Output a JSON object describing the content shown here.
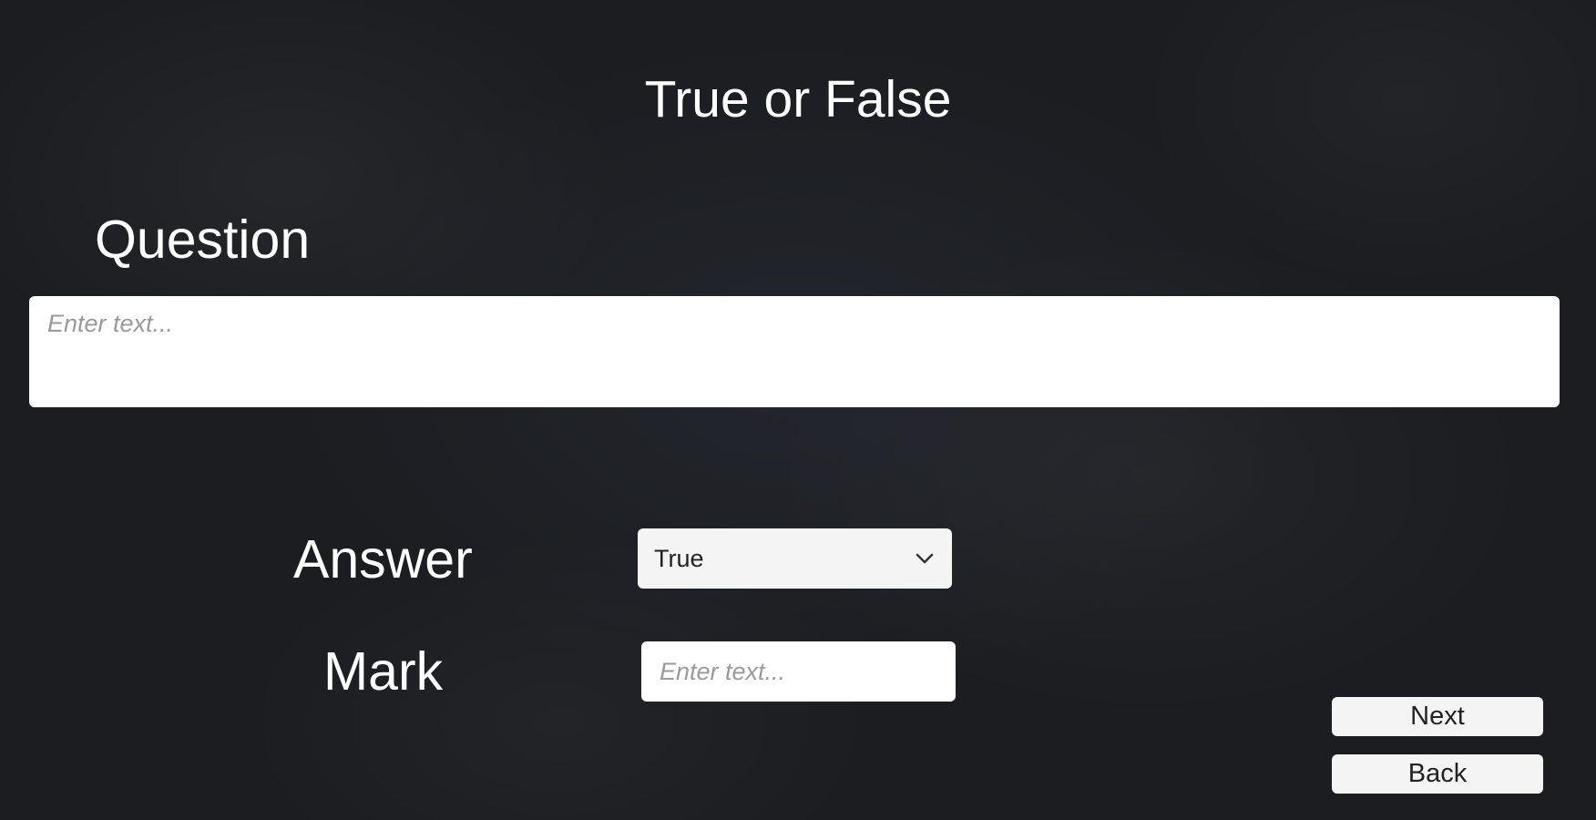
{
  "page": {
    "title": "True or False"
  },
  "question": {
    "label": "Question",
    "placeholder": "Enter text..."
  },
  "answer": {
    "label": "Answer",
    "selected": "True",
    "icon": "chevron-down-icon"
  },
  "mark": {
    "label": "Mark",
    "placeholder": "Enter text..."
  },
  "buttons": {
    "next": "Next",
    "back": "Back"
  },
  "colors": {
    "background": "#1b1d21",
    "text": "#ffffff",
    "field": "#ffffff",
    "placeholder": "#9a9a9a"
  }
}
